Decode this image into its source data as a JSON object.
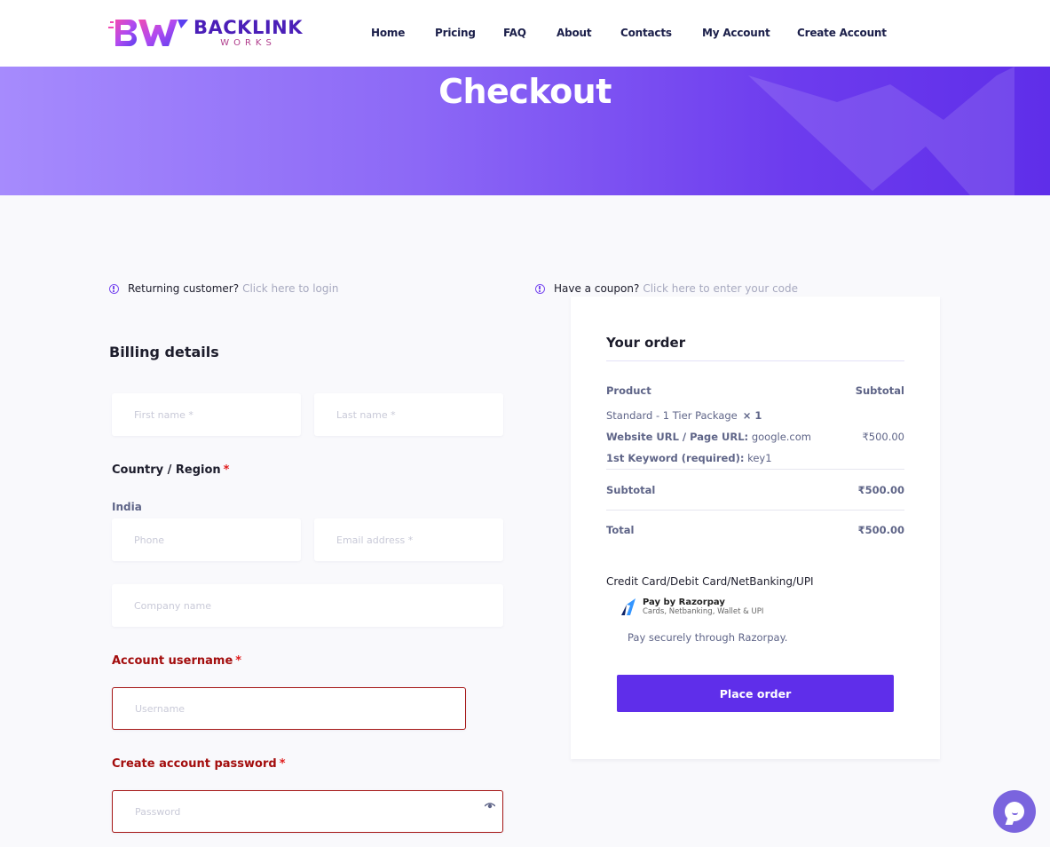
{
  "brand": {
    "logo_mark": "BW",
    "name": "BACKLINK",
    "sub": "WORKS"
  },
  "nav": [
    {
      "label": "Home"
    },
    {
      "label": "Pricing"
    },
    {
      "label": "FAQ"
    },
    {
      "label": "About"
    },
    {
      "label": "Contacts"
    },
    {
      "label": "My Account"
    },
    {
      "label": "Create Account"
    }
  ],
  "banner": {
    "title": "Checkout"
  },
  "notices": {
    "returning": {
      "text": "Returning customer?",
      "link": "Click here to login"
    },
    "coupon": {
      "text": "Have a coupon?",
      "link": "Click here to enter your code"
    }
  },
  "billing": {
    "title": "Billing details",
    "first_name_placeholder": "First name *",
    "last_name_placeholder": "Last name *",
    "country_label": "Country / Region",
    "country_value": "India",
    "phone_placeholder": "Phone",
    "email_placeholder": "Email address *",
    "company_placeholder": "Company name",
    "username_label": "Account username",
    "username_placeholder": "Username",
    "password_label": "Create account password",
    "password_placeholder": "Password",
    "required_mark": "*"
  },
  "order": {
    "title": "Your order",
    "col_product": "Product",
    "col_subtotal": "Subtotal",
    "item": {
      "name": "Standard - 1 Tier Package",
      "qty": "× 1",
      "url_label": "Website URL / Page URL:",
      "url_value": "google.com",
      "keyword_label": "1st Keyword (required):",
      "keyword_value": "key1",
      "price": "₹500.00"
    },
    "subtotal_label": "Subtotal",
    "subtotal_value": "₹500.00",
    "total_label": "Total",
    "total_value": "₹500.00",
    "payment_method": "Credit Card/Debit Card/NetBanking/UPI",
    "razorpay_title": "Pay by Razorpay",
    "razorpay_sub": "Cards, Netbanking, Wallet & UPI",
    "pay_secure": "Pay securely through Razorpay.",
    "place_order": "Place order"
  },
  "colors": {
    "accent": "#5f2eea",
    "error": "#a51616",
    "banner_start": "#a68bfd",
    "banner_end": "#5f2ee9",
    "chat": "#7a64de"
  }
}
